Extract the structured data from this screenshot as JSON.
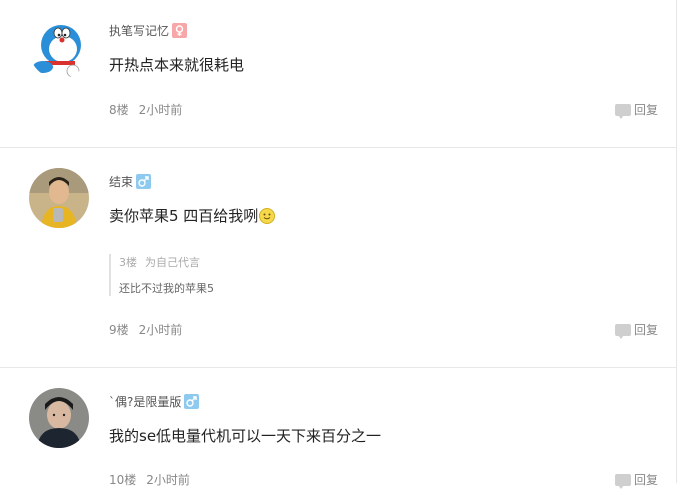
{
  "posts": [
    {
      "author": "执笔写记忆",
      "gender": "female",
      "content": "开热点本来就很耗电",
      "floor": "8楼",
      "time": "2小时前",
      "reply_label": "回复"
    },
    {
      "author": "结束",
      "gender": "male",
      "content": "卖你苹果5  四百给我咧",
      "quote": {
        "floor": "3楼",
        "label": "为自己代言",
        "text": "还比不过我的苹果5"
      },
      "floor": "9楼",
      "time": "2小时前",
      "reply_label": "回复"
    },
    {
      "author": "`偶?是限量版",
      "gender": "male",
      "content": "我的se低电量代机可以一天下来百分之一",
      "floor": "10楼",
      "time": "2小时前",
      "reply_label": "回复"
    }
  ],
  "icons": {
    "female": "female-icon",
    "male": "male-icon",
    "reply": "comment-bubble-icon",
    "emoji": "smile-emoji-icon"
  }
}
